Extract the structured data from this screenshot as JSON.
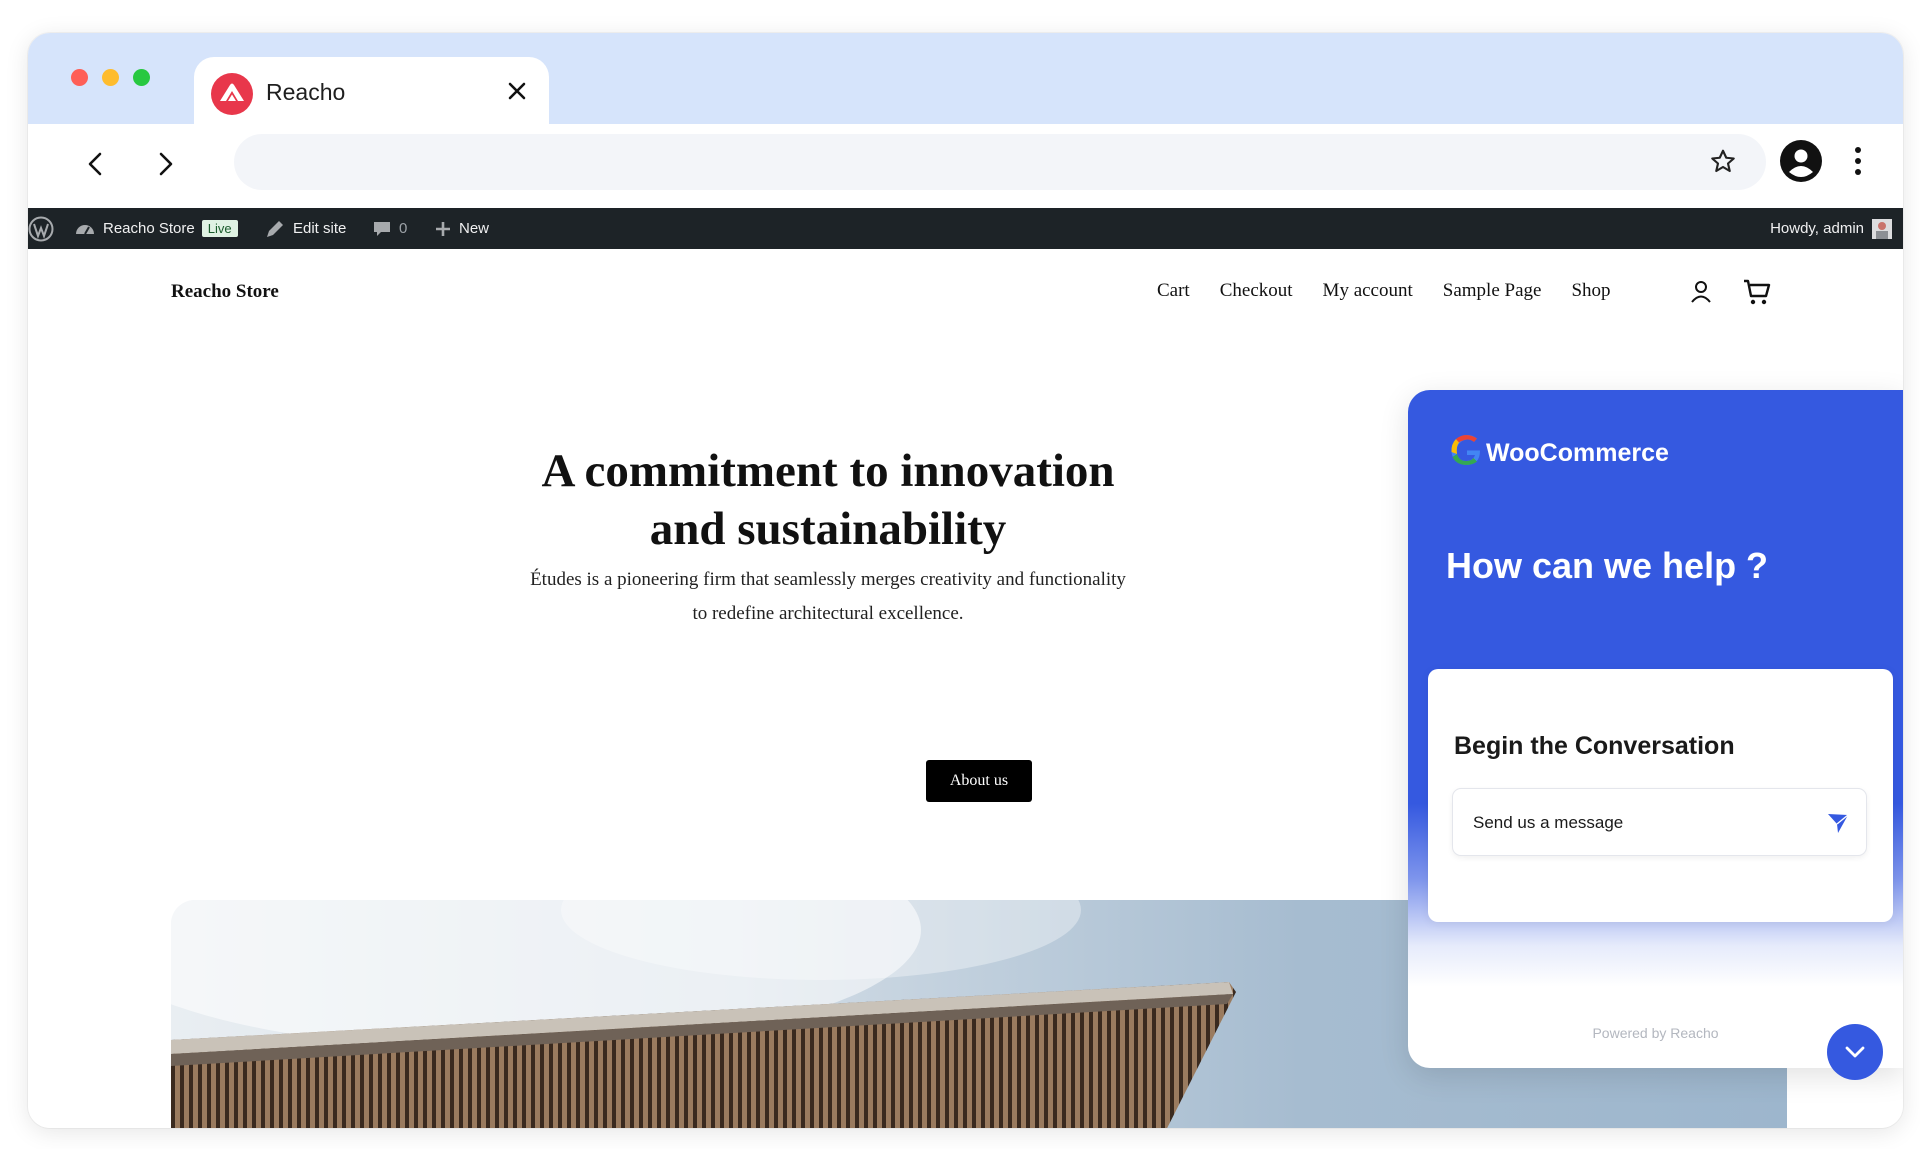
{
  "browser": {
    "tab_title": "Reacho",
    "url": ""
  },
  "admin_bar": {
    "site_name": "Reacho Store",
    "live_badge": "Live",
    "edit_site": "Edit site",
    "comments_count": "0",
    "new_label": "New",
    "howdy": "Howdy, admin"
  },
  "site": {
    "title": "Reacho Store",
    "nav": [
      "Cart",
      "Checkout",
      "My account",
      "Sample Page",
      "Shop"
    ],
    "hero_title": "A commitment to innovation and sustainability",
    "hero_subtitle": "Études is a pioneering firm that seamlessly merges creativity and functionality to redefine architectural excellence.",
    "hero_button": "About us"
  },
  "chat_widget": {
    "brand": "WooCommerce",
    "heading": "How can we help ?",
    "card_title": "Begin the Conversation",
    "input_placeholder": "Send us a message",
    "powered_by": "Powered by Reacho"
  },
  "colors": {
    "chat_blue": "#3559e0",
    "admin_bar": "#1d2327",
    "titlebar": "#d6e4fb",
    "reacho_red": "#e8374b"
  },
  "icons": [
    "close-icon",
    "back-arrow-icon",
    "forward-arrow-icon",
    "star-icon",
    "profile-icon",
    "more-vert-icon",
    "wordpress-icon",
    "dashboard-icon",
    "edit-pen-icon",
    "comment-icon",
    "plus-icon",
    "avatar",
    "user-icon",
    "cart-icon",
    "google-icon",
    "send-icon",
    "chevron-down-icon"
  ]
}
